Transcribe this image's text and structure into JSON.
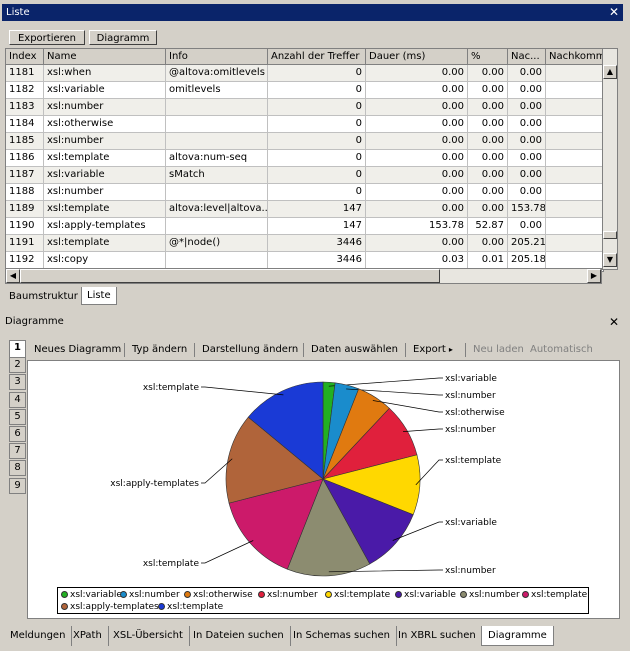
{
  "list_panel": {
    "title": "Liste",
    "export_label": "Exportieren",
    "diagram_label": "Diagramm",
    "columns": [
      "Index",
      "Name",
      "Info",
      "Anzahl der Treffer",
      "Dauer (ms)",
      "%",
      "Nac...",
      "Nachkommen ("
    ],
    "rows": [
      [
        "1181",
        "xsl:when",
        "@altova:omitlevels",
        "0",
        "0.00",
        "0.00",
        "0.00"
      ],
      [
        "1182",
        "xsl:variable",
        "omitlevels",
        "0",
        "0.00",
        "0.00",
        "0.00"
      ],
      [
        "1183",
        "xsl:number",
        "",
        "0",
        "0.00",
        "0.00",
        "0.00"
      ],
      [
        "1184",
        "xsl:otherwise",
        "",
        "0",
        "0.00",
        "0.00",
        "0.00"
      ],
      [
        "1185",
        "xsl:number",
        "",
        "0",
        "0.00",
        "0.00",
        "0.00"
      ],
      [
        "1186",
        "xsl:template",
        "altova:num-seq",
        "0",
        "0.00",
        "0.00",
        "0.00"
      ],
      [
        "1187",
        "xsl:variable",
        "sMatch",
        "0",
        "0.00",
        "0.00",
        "0.00"
      ],
      [
        "1188",
        "xsl:number",
        "",
        "0",
        "0.00",
        "0.00",
        "0.00"
      ],
      [
        "1189",
        "xsl:template",
        "altova:level|altova...",
        "147",
        "0.00",
        "0.00",
        "153.78"
      ],
      [
        "1190",
        "xsl:apply-templates",
        "",
        "147",
        "153.78",
        "52.87",
        "0.00"
      ],
      [
        "1191",
        "xsl:template",
        "@*|node()",
        "3446",
        "0.00",
        "0.00",
        "205.21"
      ],
      [
        "1192",
        "xsl:copy",
        "",
        "3446",
        "0.03",
        "0.01",
        "205.18"
      ]
    ],
    "tabs": [
      "Baumstruktur",
      "Liste"
    ]
  },
  "diagram_panel": {
    "title": "Diagramme",
    "toolbar": [
      "Neues Diagramm",
      "Typ ändern",
      "Darstellung ändern",
      "Daten auswählen",
      "Export",
      "Neu laden",
      "Automatisch"
    ],
    "side_tabs": [
      "1",
      "2",
      "3",
      "4",
      "5",
      "6",
      "7",
      "8",
      "9"
    ]
  },
  "bottom_tabs": [
    "Meldungen",
    "XPath",
    "XSL-Übersicht",
    "In Dateien suchen",
    "In Schemas suchen",
    "In XBRL suchen",
    "Diagramme"
  ],
  "chart_data": {
    "type": "pie",
    "series": [
      {
        "name": "xsl:variable",
        "values": [
          2
        ],
        "color": "#22b022"
      },
      {
        "name": "xsl:number",
        "values": [
          4
        ],
        "color": "#1a8ccc"
      },
      {
        "name": "xsl:otherwise",
        "values": [
          6
        ],
        "color": "#e07a10"
      },
      {
        "name": "xsl:number",
        "values": [
          9
        ],
        "color": "#e0203c"
      },
      {
        "name": "xsl:template",
        "values": [
          10
        ],
        "color": "#ffd800"
      },
      {
        "name": "xsl:variable",
        "values": [
          11
        ],
        "color": "#4a1aa8"
      },
      {
        "name": "xsl:number",
        "values": [
          14
        ],
        "color": "#8c8c70"
      },
      {
        "name": "xsl:template",
        "values": [
          15
        ],
        "color": "#cc1a6a"
      },
      {
        "name": "xsl:apply-templates",
        "values": [
          15
        ],
        "color": "#b0643a"
      },
      {
        "name": "xsl:template",
        "values": [
          14
        ],
        "color": "#1a3ad6"
      }
    ]
  }
}
